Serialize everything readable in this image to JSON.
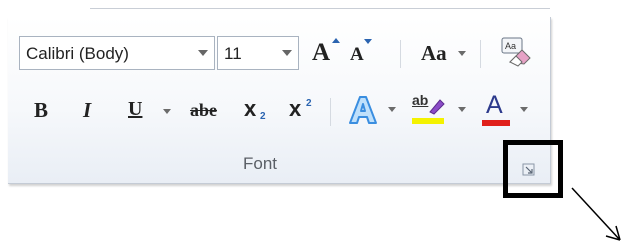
{
  "font_group": {
    "font_name": "Calibri (Body)",
    "font_size": "11",
    "grow_font_glyph": "A",
    "shrink_font_glyph": "A",
    "change_case_glyph": "Aa",
    "clear_formatting_glyph": "Aa",
    "bold_glyph": "B",
    "italic_glyph": "I",
    "underline_glyph": "U",
    "strike_glyph": "abe",
    "subscript_glyph": "x",
    "subscript_index": "2",
    "superscript_glyph": "x",
    "superscript_index": "2",
    "highlight_glyph": "ab",
    "font_color_glyph": "A",
    "label": "Font"
  },
  "colors": {
    "highlight": "#f4f200",
    "font_color": "#e0201b",
    "text_effect": "#3a8ee0"
  }
}
